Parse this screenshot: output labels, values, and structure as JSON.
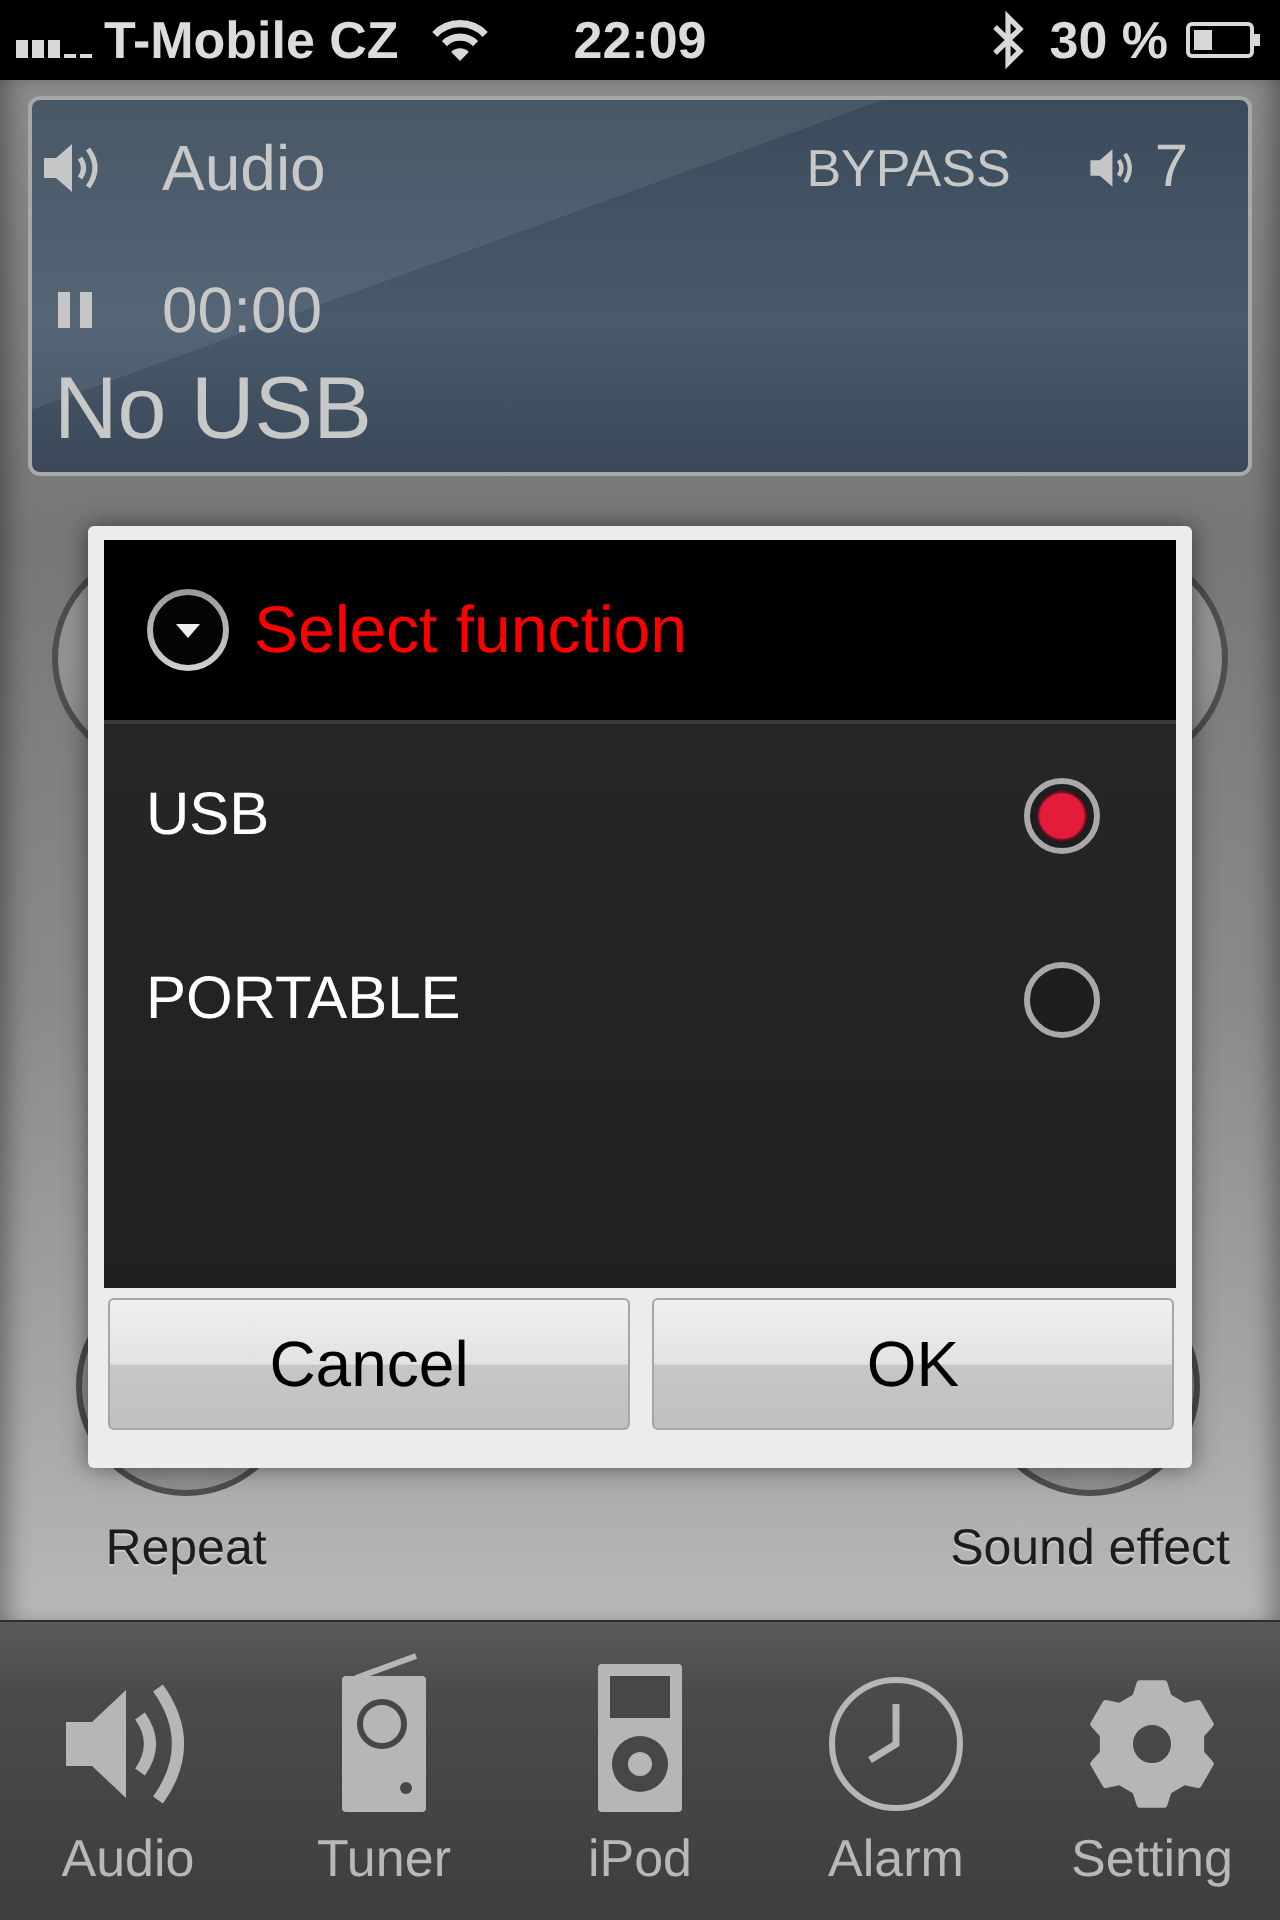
{
  "status_bar": {
    "carrier": "T-Mobile CZ",
    "time": "22:09",
    "battery": "30 %"
  },
  "display": {
    "source": "Audio",
    "mode": "BYPASS",
    "volume": "7",
    "elapsed": "00:00",
    "track": "No USB"
  },
  "controls": [
    {
      "label": "Repeat"
    },
    {
      "label": "Sound effect"
    }
  ],
  "dialog": {
    "title": "Select function",
    "options": [
      {
        "label": "USB",
        "selected": true
      },
      {
        "label": "PORTABLE",
        "selected": false
      }
    ],
    "buttons": [
      "Cancel",
      "OK"
    ]
  },
  "tab_bar": [
    {
      "label": "Audio",
      "kind": "speaker"
    },
    {
      "label": "Tuner",
      "kind": "radio"
    },
    {
      "label": "iPod",
      "kind": "player"
    },
    {
      "label": "Alarm",
      "kind": "clock"
    },
    {
      "label": "Setting",
      "kind": "gear"
    }
  ]
}
